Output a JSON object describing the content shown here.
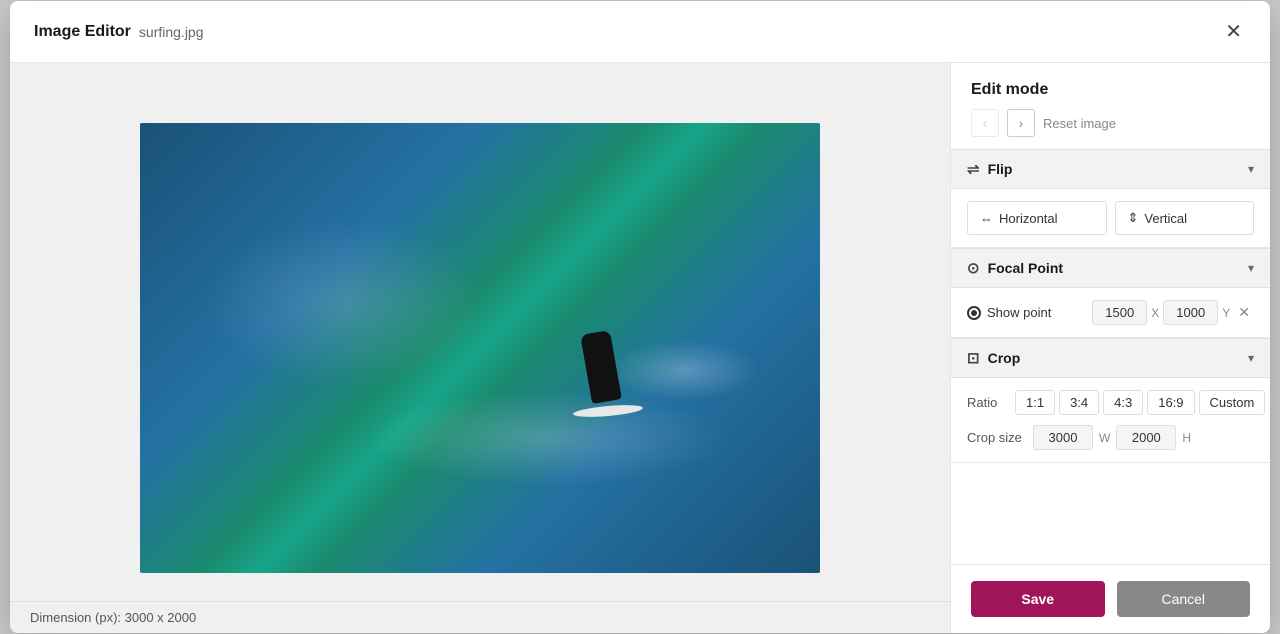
{
  "dialog": {
    "title": "Image Editor",
    "filename": "surfing.jpg",
    "close_label": "✕"
  },
  "image": {
    "dimension_label": "Dimension (px): 3000 x 2000"
  },
  "edit_mode": {
    "header": "Edit mode",
    "nav_back": "‹",
    "nav_forward": "›",
    "reset_label": "Reset image"
  },
  "flip_section": {
    "label": "Flip",
    "horizontal_label": "Horizontal",
    "vertical_label": "Vertical"
  },
  "focal_section": {
    "label": "Focal Point",
    "show_point_label": "Show point",
    "x_value": "1500",
    "x_label": "X",
    "y_value": "1000",
    "y_label": "Y"
  },
  "crop_section": {
    "label": "Crop",
    "ratio_label": "Ratio",
    "ratios": [
      "1:1",
      "3:4",
      "4:3",
      "16:9",
      "Custom"
    ],
    "crop_size_label": "Crop size",
    "width_value": "3000",
    "width_label": "W",
    "height_value": "2000",
    "height_label": "H"
  },
  "actions": {
    "save_label": "Save",
    "cancel_label": "Cancel"
  }
}
